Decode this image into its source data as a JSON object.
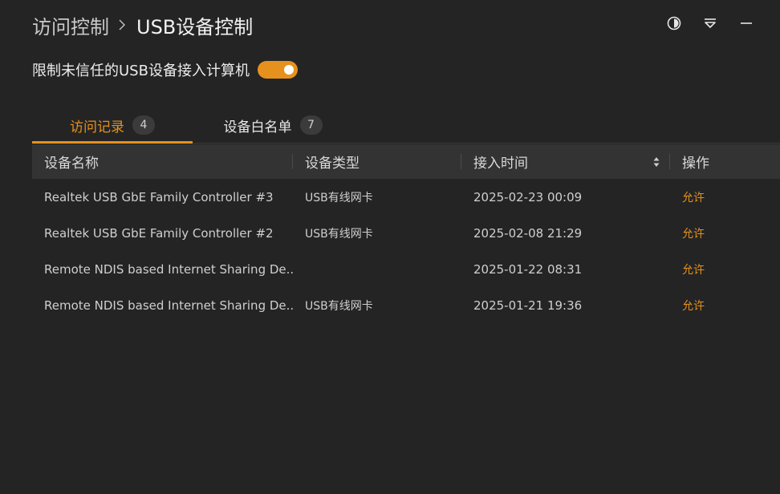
{
  "header": {
    "parent": "访问控制",
    "current": "USB设备控制"
  },
  "window_controls": {
    "icons": [
      "half-circle-icon",
      "dropdown-icon",
      "minimize-icon"
    ]
  },
  "toggle": {
    "label": "限制未信任的USB设备接入计算机",
    "on": true,
    "color": "#e6911d"
  },
  "tabs": [
    {
      "label": "访问记录",
      "count": "4",
      "active": true
    },
    {
      "label": "设备白名单",
      "count": "7",
      "active": false
    }
  ],
  "table": {
    "headers": [
      "设备名称",
      "设备类型",
      "接入时间",
      "操作"
    ],
    "rows": [
      {
        "name": "Realtek USB GbE Family Controller #3",
        "type": "USB有线网卡",
        "time": "2025-02-23 00:09",
        "action": "允许"
      },
      {
        "name": "Realtek USB GbE Family Controller #2",
        "type": "USB有线网卡",
        "time": "2025-02-08 21:29",
        "action": "允许"
      },
      {
        "name": "Remote NDIS based Internet Sharing De...",
        "type": "",
        "time": "2025-01-22 08:31",
        "action": "允许"
      },
      {
        "name": "Remote NDIS based Internet Sharing De...",
        "type": "USB有线网卡",
        "time": "2025-01-21 19:36",
        "action": "允许"
      }
    ]
  }
}
